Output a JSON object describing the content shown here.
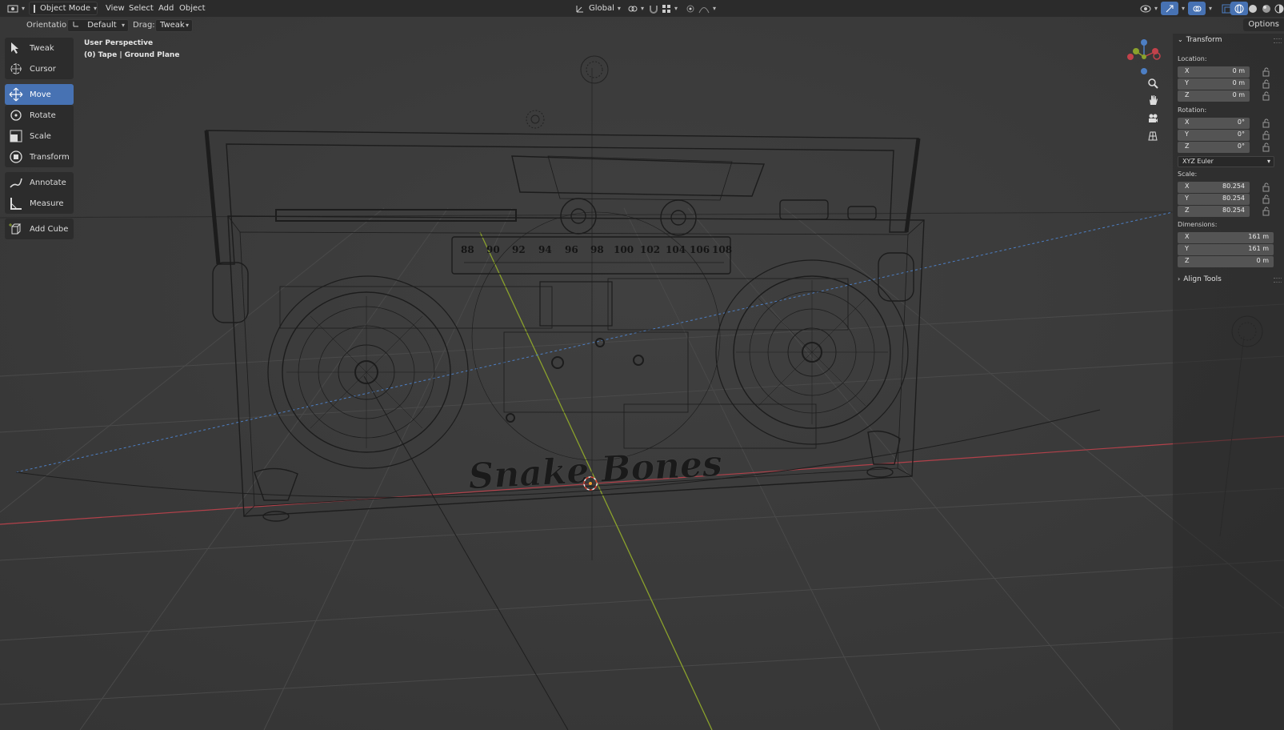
{
  "header": {
    "mode": "Object Mode",
    "menus": [
      "View",
      "Select",
      "Add",
      "Object"
    ],
    "transform_orientation": "Global"
  },
  "tool_settings": {
    "orientation_label": "Orientation:",
    "orientation_value": "Default",
    "drag_label": "Drag:",
    "drag_value": "Tweak",
    "options_label": "Options"
  },
  "toolbar": {
    "tools": [
      {
        "label": "Tweak",
        "icon": "tweak-icon",
        "active": false
      },
      {
        "label": "Cursor",
        "icon": "cursor-icon",
        "active": false
      },
      {
        "label": "Move",
        "icon": "move-icon",
        "active": true
      },
      {
        "label": "Rotate",
        "icon": "rotate-icon",
        "active": false
      },
      {
        "label": "Scale",
        "icon": "scale-icon",
        "active": false
      },
      {
        "label": "Transform",
        "icon": "transform-icon",
        "active": false
      },
      {
        "label": "Annotate",
        "icon": "annotate-icon",
        "active": false
      },
      {
        "label": "Measure",
        "icon": "measure-icon",
        "active": false
      },
      {
        "label": "Add Cube",
        "icon": "add-cube-icon",
        "active": false
      }
    ]
  },
  "viewport": {
    "perspective": "User Perspective",
    "object_info": "(0) Tape | Ground Plane",
    "logo_text": "Snake Bones",
    "dial_numbers": [
      "88",
      "90",
      "92",
      "94",
      "96",
      "98",
      "100",
      "102",
      "104",
      "106",
      "108"
    ]
  },
  "sidebar": {
    "panel_title": "Transform",
    "location": {
      "label": "Location:",
      "x": "0 m",
      "y": "0 m",
      "z": "0 m"
    },
    "rotation": {
      "label": "Rotation:",
      "x": "0°",
      "y": "0°",
      "z": "0°",
      "mode": "XYZ Euler"
    },
    "scale": {
      "label": "Scale:",
      "x": "80.254",
      "y": "80.254",
      "z": "80.254"
    },
    "dimensions": {
      "label": "Dimensions:",
      "x": "161 m",
      "y": "161 m",
      "z": "0 m"
    },
    "align_tools": "Align Tools",
    "axis_labels": {
      "x": "X",
      "y": "Y",
      "z": "Z"
    }
  },
  "colors": {
    "accent": "#4772b3",
    "x_axis": "#c2424b",
    "y_axis": "#8aa12c",
    "z_axis": "#4d7fc4"
  }
}
